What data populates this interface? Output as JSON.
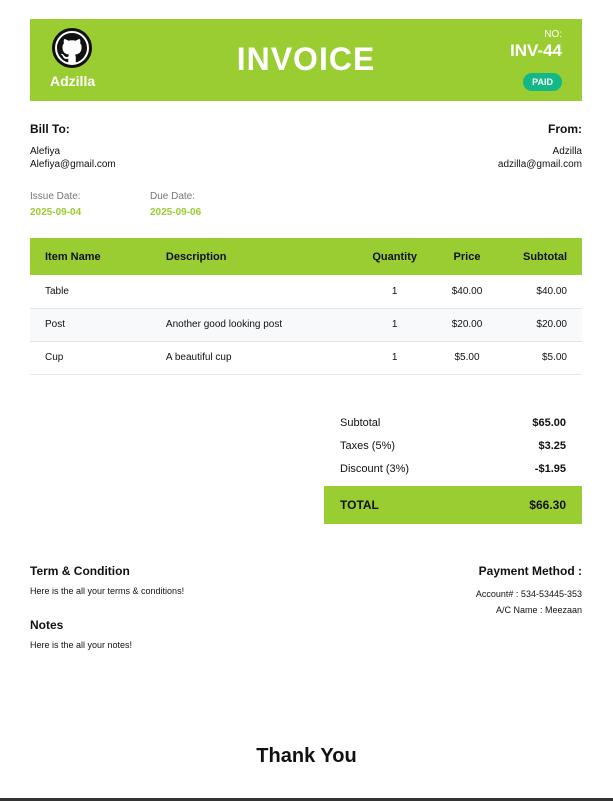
{
  "header": {
    "brand": "Adzilla",
    "title": "INVOICE",
    "no_label": "NO:",
    "invoice_no": "INV-44",
    "status": "PAID",
    "accent_color": "#9acd32",
    "status_color": "#12b886",
    "logo_icon": "github-octocat-icon"
  },
  "bill_to": {
    "heading": "Bill To:",
    "name": "Alefiya",
    "email": "Alefiya@gmail.com"
  },
  "from": {
    "heading": "From:",
    "name": "Adzilla",
    "email": "adzilla@gmail.com"
  },
  "dates": {
    "issue_label": "Issue Date:",
    "issue_value": "2025-09-04",
    "due_label": "Due Date:",
    "due_value": "2025-09-06"
  },
  "items": {
    "columns": [
      "Item Name",
      "Description",
      "Quantity",
      "Price",
      "Subtotal"
    ],
    "rows": [
      {
        "name": "Table",
        "description": "",
        "qty": "1",
        "price": "$40.00",
        "subtotal": "$40.00"
      },
      {
        "name": "Post",
        "description": "Another good looking post",
        "qty": "1",
        "price": "$20.00",
        "subtotal": "$20.00"
      },
      {
        "name": "Cup",
        "description": "A beautiful cup",
        "qty": "1",
        "price": "$5.00",
        "subtotal": "$5.00"
      }
    ]
  },
  "totals": {
    "subtotal_label": "Subtotal",
    "subtotal_value": "$65.00",
    "tax_label": "Taxes (5%)",
    "tax_value": "$3.25",
    "discount_label": "Discount (3%)",
    "discount_value": "-$1.95",
    "total_label": "TOTAL",
    "total_value": "$66.30"
  },
  "terms": {
    "heading": "Term & Condition",
    "text": "Here is the all your terms & conditions!"
  },
  "notes": {
    "heading": "Notes",
    "text": "Here is the all your notes!"
  },
  "payment": {
    "heading": "Payment Method :",
    "account": "Account# : 534-53445-353",
    "name": "A/C Name : Meezaan"
  },
  "footer": {
    "thanks": "Thank You"
  }
}
